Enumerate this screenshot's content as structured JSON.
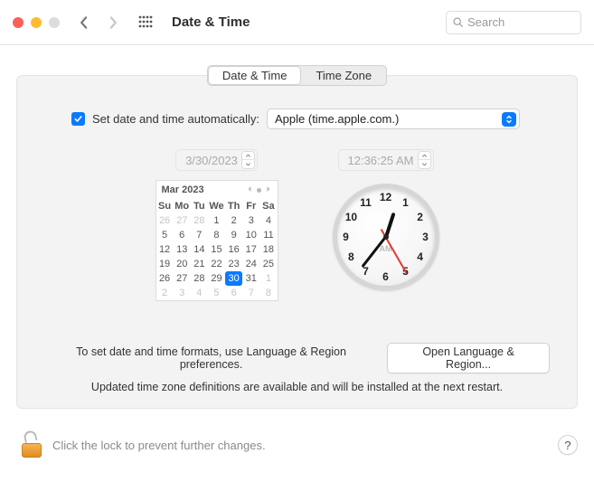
{
  "window": {
    "title": "Date & Time",
    "search_placeholder": "Search"
  },
  "tabs": {
    "date_time": "Date & Time",
    "time_zone": "Time Zone"
  },
  "auto": {
    "checked": true,
    "label": "Set date and time automatically:",
    "server": "Apple (time.apple.com.)"
  },
  "date_field": "3/30/2023",
  "time_field": "12:36:25 AM",
  "calendar": {
    "title": "Mar 2023",
    "dow": [
      "Su",
      "Mo",
      "Tu",
      "We",
      "Th",
      "Fr",
      "Sa"
    ],
    "leading": [
      26,
      27,
      28
    ],
    "days": [
      1,
      2,
      3,
      4,
      5,
      6,
      7,
      8,
      9,
      10,
      11,
      12,
      13,
      14,
      15,
      16,
      17,
      18,
      19,
      20,
      21,
      22,
      23,
      24,
      25,
      26,
      27,
      28,
      29,
      30,
      31
    ],
    "trailing": [
      1,
      2,
      3,
      4,
      5,
      6,
      7,
      8
    ],
    "today": 30
  },
  "clock": {
    "ampm": "AM",
    "hour_angle": 18,
    "minute_angle": 218,
    "second_angle": 150
  },
  "footer": {
    "format_hint": "To set date and time formats, use Language & Region preferences.",
    "open_button": "Open Language & Region...",
    "tz_note": "Updated time zone definitions are available and will be installed at the next restart."
  },
  "lock": {
    "text": "Click the lock to prevent further changes.",
    "help": "?"
  }
}
